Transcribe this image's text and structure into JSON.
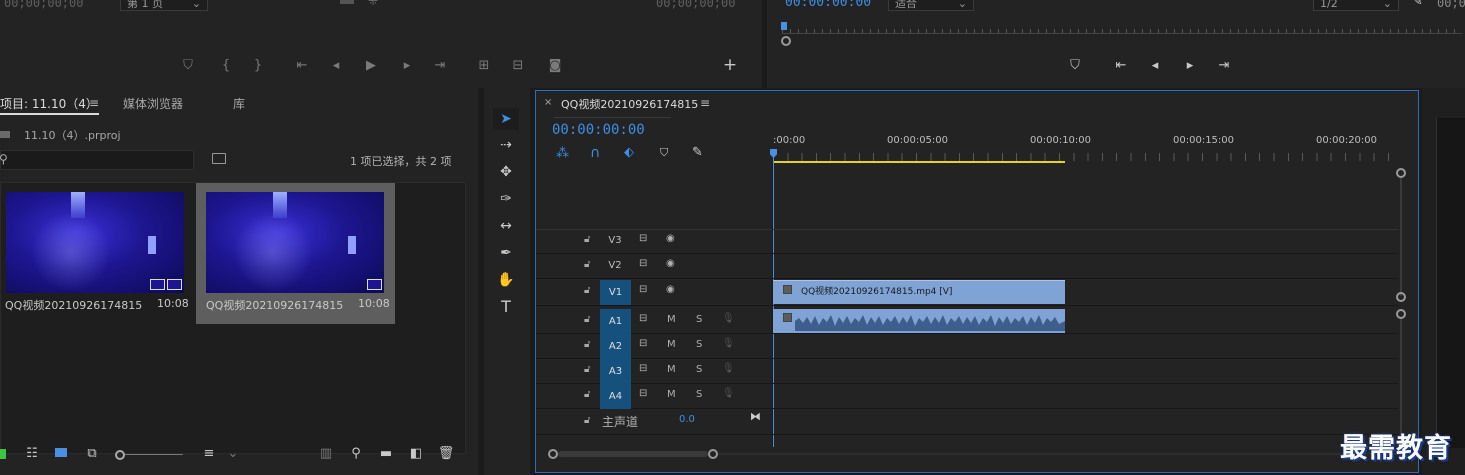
{
  "source_monitor": {
    "timecode_left": "00;00;00;00",
    "page_select": "第 1 页",
    "timecode_right": "00;00;00;00",
    "add_label": "+"
  },
  "program_monitor": {
    "timecode": "00:00:00:00",
    "fit_select": "适合",
    "quality_select": "1/2",
    "timecode_right": "00;0"
  },
  "project": {
    "tabs": [
      "项目: 11.10（4）",
      "媒体浏览器",
      "库"
    ],
    "file_name": "11.10（4）.prproj",
    "search_placeholder": "",
    "selection_status": "1 项已选择，共 2 项",
    "items": [
      {
        "name": "QQ视频20210926174815...",
        "duration": "10:08",
        "selected": false
      },
      {
        "name": "QQ视频20210926174815",
        "duration": "10:08",
        "selected": true
      }
    ]
  },
  "timeline": {
    "title": "QQ视频20210926174815",
    "timecode": "00:00:00:00",
    "ruler": [
      ":00:00",
      "00:00:05:00",
      "00:00:10:00",
      "00:00:15:00",
      "00:00:20:00"
    ],
    "video_tracks": [
      "V3",
      "V2",
      "V1"
    ],
    "audio_tracks": [
      "A1",
      "A2",
      "A3",
      "A4"
    ],
    "mute_label": "M",
    "solo_label": "S",
    "master_label": "主声道",
    "master_value": "0.0",
    "video_clip_label": "QQ视频20210926174815.mp4 [V]"
  },
  "watermark": "最需教育",
  "colors": {
    "accent_blue": "#3d8ee6",
    "track_on": "#16507d",
    "clip_blue": "#7ea3d4",
    "playhead": "#4a90e2",
    "work_area": "#e6d41c"
  }
}
